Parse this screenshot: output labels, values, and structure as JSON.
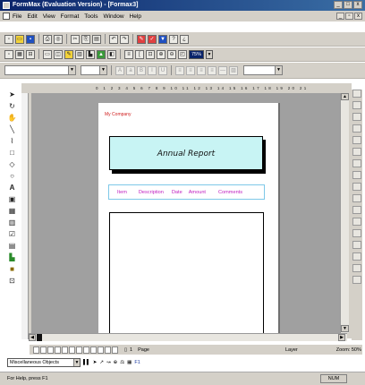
{
  "window": {
    "title": "FormMax (Evaluation Version) - [Formax3]",
    "controls": [
      "_",
      "□",
      "x"
    ]
  },
  "menu": [
    "File",
    "Edit",
    "View",
    "Format",
    "Tools",
    "Window",
    "Help"
  ],
  "toolbar": {
    "zoom_value": "75%"
  },
  "document": {
    "company": "My Company",
    "report_title": "Annual Report",
    "columns": [
      "Item",
      "Description",
      "Date",
      "Amount",
      "Comments"
    ]
  },
  "ruler_numbers": "0 1 2 3 4 5 6 7 8 9 10 11 12 13 14 15 16 17 18 19 20 21",
  "bottom_bar": {
    "page_number": "1",
    "page_label": "Page",
    "layer_label": "Layer",
    "zoom_text": "Zoom: 50%"
  },
  "object_bar": {
    "selected": "Miscellaneous Objects",
    "help_key": "F1"
  },
  "status": {
    "help_text": "For Help, press F1",
    "num_indicator": "NUM"
  }
}
